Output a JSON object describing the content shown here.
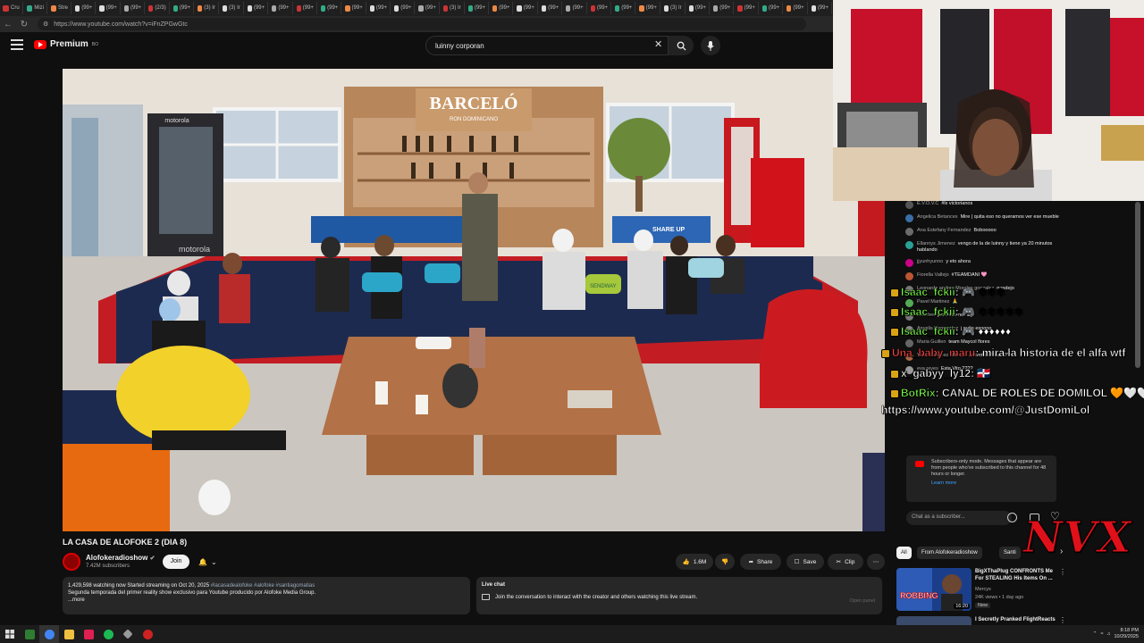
{
  "browser": {
    "tabs": [
      "Cru",
      "Mizi",
      "Stre",
      "(99+",
      "(99+",
      "(99+",
      "(2/3)",
      "(99+",
      "(3) Ir",
      "(3) Ir",
      "(99+",
      "(99+",
      "(99+",
      "(99+",
      "(99+",
      "(99+",
      "(99+",
      "(99+",
      "(3) Ir",
      "(99+",
      "(99+",
      "(99+",
      "(99+",
      "(99+",
      "(99+",
      "(99+",
      "(99+",
      "(3) Ir",
      "(99+",
      "(99+",
      "(99+",
      "(99+",
      "(99+",
      "(99+"
    ],
    "url": "https://www.youtube.com/watch?v=iFnZPGwGtc"
  },
  "header": {
    "brand": "Premium",
    "brand_sup": "BO",
    "search_value": "luinny corporan"
  },
  "video_scene": {
    "sign_title": "BARCELÓ",
    "sign_subtitle": "RON DOMINICANO",
    "fridge_brand": "motorola",
    "floor_brand": "motorola",
    "pillow_text": "SENDWAY",
    "sign_small": "SHARE UP"
  },
  "chat": {
    "messages": [
      {
        "author": "E.V.O.V.C",
        "text": "#lx victorianos",
        "color": "#555"
      },
      {
        "author": "Angelica Betances",
        "text": "Mire | quita eso no queramos ver ese mueble",
        "color": "#3a6ea5"
      },
      {
        "author": "Ana Estefany Fernandez",
        "text": "Bobooooo",
        "color": "#6b6b6b"
      },
      {
        "author": "Ellannys Jimenez",
        "text": "vengo de la de luinny y tiene ya 20 minutos hablando",
        "color": "#2aa198"
      },
      {
        "author": "jjyunhyunno",
        "text": "y eto ahora",
        "color": "#c08"
      },
      {
        "author": "Fiorella Vallejo",
        "text": "#TEAMDANI 🩷",
        "color": "#b53"
      },
      {
        "author": "Leonardo andres Morales gonzalez",
        "text": "pendejo",
        "color": "#777"
      },
      {
        "author": "Pavel Martinez",
        "text": "🙏",
        "color": "#5a5"
      },
      {
        "author": "Member",
        "text": "pare eso no hay",
        "color": "#777"
      },
      {
        "author": "Anyelis Hernandez",
        "text": "j quita esoooo",
        "color": "#888"
      },
      {
        "author": "Maria Guillen",
        "text": "team Maycol flores",
        "color": "#666"
      },
      {
        "author": "Ylda Gutierrez",
        "text": "J & que hacemos hora ???",
        "color": "#a64"
      },
      {
        "author": "eva reyes",
        "text": "Esta Vito ????",
        "color": "#999"
      }
    ],
    "subscriber_notice": "Subscribers-only mode. Messages that appear are from people who've subscribed to this channel for 48 hours or longer.",
    "learn_more": "Learn more",
    "input_placeholder": "Chat as a subscriber..."
  },
  "overlay": {
    "lines": [
      {
        "user": "Isaac_fckii",
        "text": ": 🎮 ❄❄❄",
        "color": "#7cff4a"
      },
      {
        "user": "Isaac_fckii",
        "text": ": 🎮 ❄❄❄❄❄",
        "color": "#7cff4a"
      },
      {
        "user": "Isaac_fckii",
        "text": ": 🎮 ♦♦♦♦♦♦",
        "color": "#7cff4a"
      },
      {
        "user": "Una_baby_maru",
        "text": ": mira la historia de el alfa wtf",
        "color": "#ff4444"
      },
      {
        "user": "x_gabyy_ly12",
        "text": ": 🇩🇴",
        "color": "#ffffff"
      },
      {
        "user": "BotRix",
        "text": ": CANAL DE ROLES DE DOMILOL 🧡🤍🤍",
        "color": "#7cff4a"
      }
    ],
    "link": "https://www.youtube.com/@JustDomiLol",
    "watermark": "NVX"
  },
  "video_info": {
    "title": "LA CASA DE ALOFOKE 2 (DIA 8)",
    "channel": "Alofokeradioshow",
    "subscribers": "7.42M subscribers",
    "join_label": "Join",
    "likes": "1.6M",
    "share_label": "Share",
    "save_label": "Save",
    "clip_label": "Clip",
    "desc_stats": "1,429,598 watching now  Started streaming on Oct 20, 2025",
    "desc_tags": "#lacasadealofoke #alofoke #santiagomatias",
    "desc_text": "Segunda temporada del primer reality show exclusivo para Youtube producido por Alofoke Media Group.",
    "desc_more": "...more",
    "live_chat_title": "Live chat",
    "live_chat_text": "Join the conversation to interact with the creator and others watching this live stream.",
    "open_panel": "Open panel"
  },
  "recommendations": {
    "chips": [
      "All",
      "From Alofokeradioshow",
      "Santi"
    ],
    "items": [
      {
        "title": "BigXThaPlug CONFRONTS Me For STEALING His Items On ...",
        "channel": "Mercys",
        "meta": "24K views • 1 day ago",
        "badge": "New",
        "duration": "16:20",
        "thumb_text": "ROBBING"
      },
      {
        "title": "I Secretly Pranked FlightReacts",
        "channel": "",
        "meta": "",
        "badge": "",
        "duration": "",
        "thumb_text": ""
      }
    ]
  },
  "taskbar": {
    "time": "8:18 PM",
    "date": "10/29/2025"
  },
  "colors": {
    "yt_red": "#ff0000",
    "bg": "#0f0f0f",
    "overlay_green": "#7cff4a",
    "watermark_red": "#e0101a"
  }
}
